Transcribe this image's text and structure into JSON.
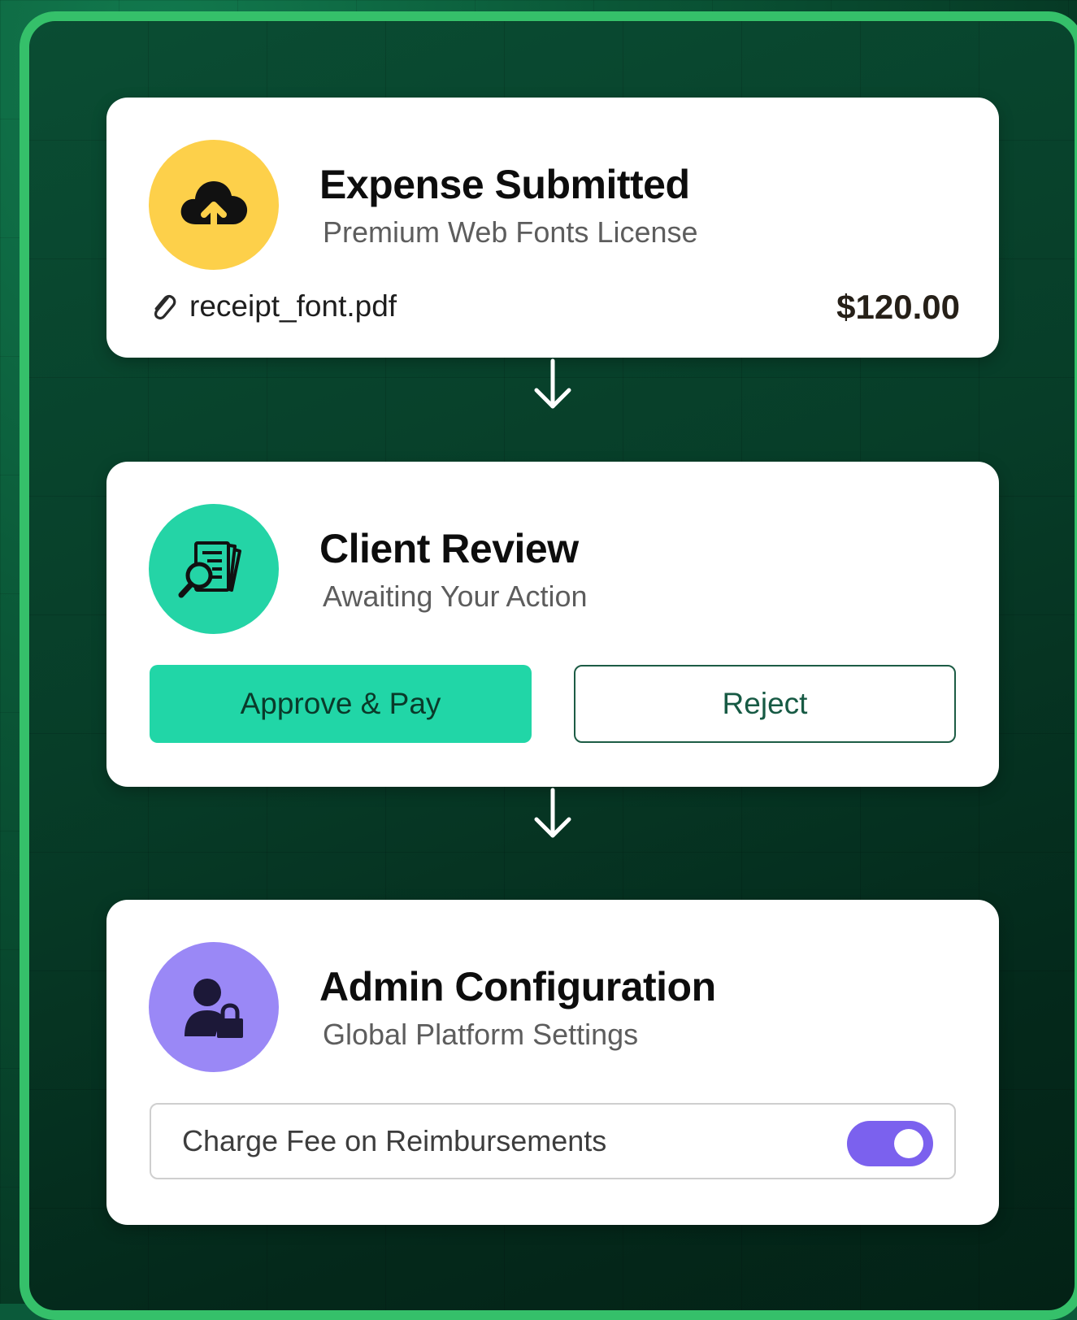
{
  "steps": [
    {
      "title": "Expense Submitted",
      "subtitle": "Premium Web Fonts License",
      "icon": "cloud-upload-icon",
      "icon_bg": "#fdd04a",
      "attachment": "receipt_font.pdf",
      "amount": "$120.00"
    },
    {
      "title": "Client Review",
      "subtitle": "Awaiting Your Action",
      "icon": "document-search-icon",
      "icon_bg": "#24d4a6",
      "approve_label": "Approve & Pay",
      "reject_label": "Reject"
    },
    {
      "title": "Admin Configuration",
      "subtitle": "Global Platform Settings",
      "icon": "user-lock-icon",
      "icon_bg": "#9a88f6",
      "setting_label": "Charge Fee on Reimbursements",
      "setting_enabled": true
    }
  ],
  "colors": {
    "frame_border": "#35c06a",
    "approve": "#21d6a7",
    "toggle_on": "#7b61ee"
  }
}
